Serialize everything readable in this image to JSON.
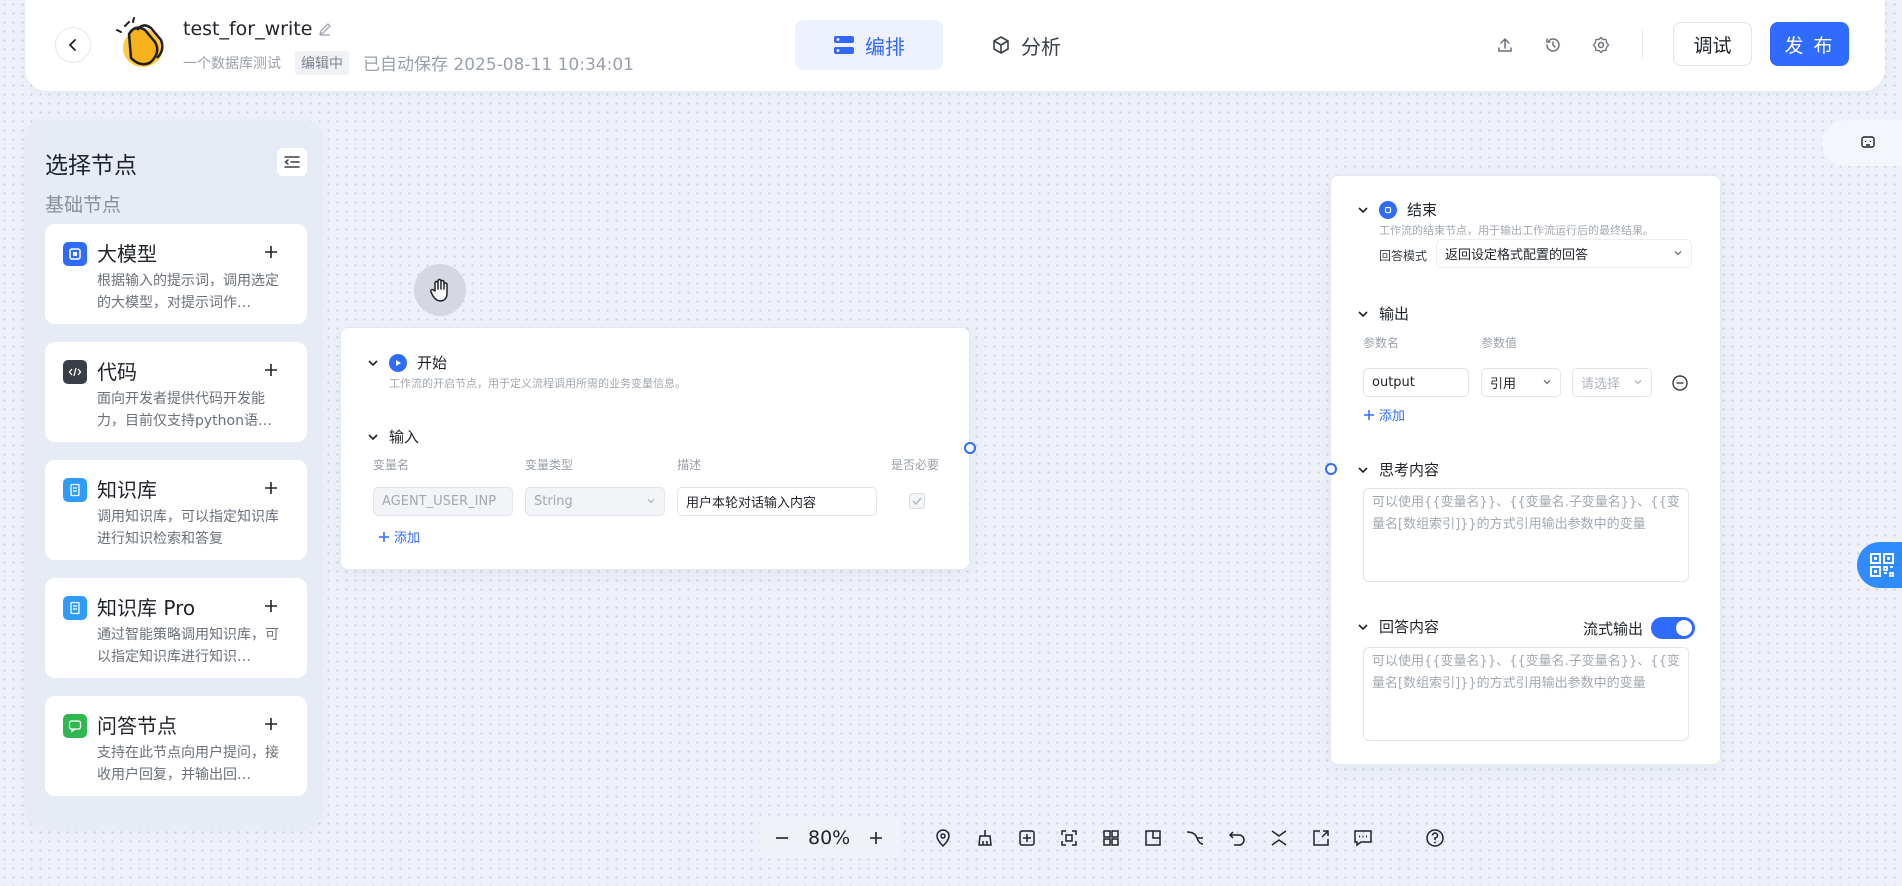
{
  "header": {
    "app_title": "test_for_write",
    "app_description": "一个数据库测试",
    "edit_badge": "编辑中",
    "autosave": "已自动保存 2025-08-11 10:34:01",
    "tabs": [
      {
        "label": "编排",
        "icon": "workflow-icon",
        "active": true
      },
      {
        "label": "分析",
        "icon": "cube-icon",
        "active": false
      }
    ],
    "icons": [
      "upload-icon",
      "history-icon",
      "settings-icon"
    ],
    "debug_label": "调试",
    "publish_label": "发 布"
  },
  "palette": {
    "title": "选择节点",
    "section": "基础节点",
    "nodes": [
      {
        "name": "大模型",
        "desc": "根据输入的提示词，调用选定的大模型，对提示词作…",
        "icon_color": "#2f6bff"
      },
      {
        "name": "代码",
        "desc": "面向开发者提供代码开发能力，目前仅支持python语…",
        "icon_color": "#3a3f47"
      },
      {
        "name": "知识库",
        "desc": "调用知识库，可以指定知识库进行知识检索和答复",
        "icon_color": "#2f9bff"
      },
      {
        "name": "知识库 Pro",
        "desc": "通过智能策略调用知识库，可以指定知识库进行知识…",
        "icon_color": "#2f9bff"
      },
      {
        "name": "问答节点",
        "desc": "支持在此节点向用户提问，接收用户回复，并输出回…",
        "icon_color": "#2fb84f"
      }
    ]
  },
  "start_node": {
    "title": "开始",
    "desc": "工作流的开启节点，用于定义流程调用所需的业务变量信息。",
    "input_section": "输入",
    "columns": [
      "变量名",
      "变量类型",
      "描述",
      "是否必要"
    ],
    "var_name": "AGENT_USER_INP",
    "var_type": "String",
    "var_desc": "用户本轮对话输入内容",
    "add_label": "添加"
  },
  "end_node": {
    "title": "结束",
    "desc": "工作流的结束节点，用于输出工作流运行后的最终结果。",
    "mode_label": "回答模式",
    "mode_value": "返回设定格式配置的回答",
    "output_section": "输出",
    "columns": [
      "参数名",
      "参数值"
    ],
    "param_name": "output",
    "param_type": "引用",
    "param_placeholder": "请选择",
    "add_label": "添加",
    "think_section": "思考内容",
    "think_placeholder": "可以使用{{变量名}}、{{变量名.子变量名}}、{{变量名[数组索引]}}的方式引用输出参数中的变量",
    "answer_section": "回答内容",
    "stream_label": "流式输出",
    "stream_on": true,
    "answer_placeholder": "可以使用{{变量名}}、{{变量名.子变量名}}、{{变量名[数组索引]}}的方式引用输出参数中的变量"
  },
  "toolbar": {
    "zoom": "80%",
    "icons": [
      "locate-icon",
      "clean-icon",
      "add-note-icon",
      "fit-view-icon",
      "layout-icon",
      "minimap-icon",
      "connector-icon",
      "undo-icon",
      "collapse-icon",
      "export-icon",
      "comment-icon",
      "help-icon"
    ]
  },
  "colors": {
    "accent": "#2f6bff",
    "canvas": "#eef1f9"
  }
}
